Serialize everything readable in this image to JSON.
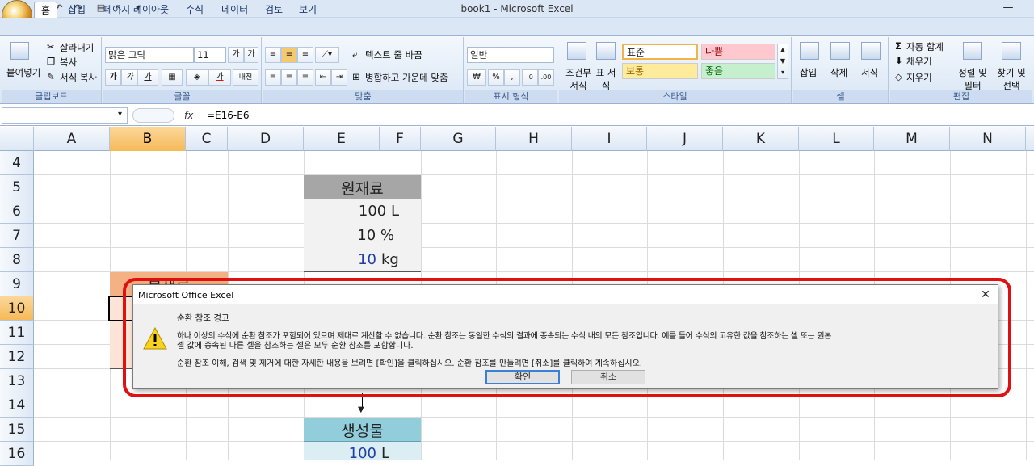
{
  "window": {
    "title": "book1 - Microsoft Excel",
    "minimize": "—"
  },
  "tabs": [
    "홈",
    "삽입",
    "페이지 레이아웃",
    "수식",
    "데이터",
    "검토",
    "보기"
  ],
  "ribbon": {
    "clipboard": {
      "label": "클립보드",
      "paste": "붙여넣기",
      "cut": "잘라내기",
      "copy": "복사",
      "format_painter": "서식 복사"
    },
    "font": {
      "label": "글꼴",
      "name": "맑은 고딕",
      "size": "11",
      "grow": "가",
      "shrink": "가",
      "bold": "가",
      "italic": "가",
      "underline": "가",
      "font_color": "가",
      "phonetic": "내천"
    },
    "alignment": {
      "label": "맞춤",
      "wrap": "텍스트 줄 바꿈",
      "merge": "병합하고 가운데 맞춤"
    },
    "number": {
      "label": "표시 형식",
      "format": "일반",
      "currency": "₩",
      "percent": "%",
      "comma": ","
    },
    "styles": {
      "label": "스타일",
      "conditional": "조건부 서식",
      "table": "표 서식",
      "normal": "표준",
      "bad": "나쁨",
      "neutral": "보통",
      "good": "좋음"
    },
    "cells": {
      "label": "셀",
      "insert": "삽입",
      "delete": "삭제",
      "format": "서식"
    },
    "editing": {
      "label": "편집",
      "autosum": "자동 합계",
      "fill": "채우기",
      "clear": "지우기",
      "sort": "정렬 및 필터",
      "find": "찾기 및 선택"
    }
  },
  "formula_bar": {
    "fx": "fx",
    "formula": "=E16-E6"
  },
  "columns": [
    "A",
    "B",
    "C",
    "D",
    "E",
    "F",
    "G",
    "H",
    "I",
    "J",
    "K",
    "L",
    "M",
    "N"
  ],
  "rows": [
    "4",
    "5",
    "6",
    "7",
    "8",
    "9",
    "10",
    "11",
    "12",
    "13",
    "14",
    "15",
    "16"
  ],
  "cells": {
    "raw_header": "원재료",
    "raw_1": "100 L",
    "raw_2": "10 %",
    "raw_3_num": "10",
    "raw_3_unit": "kg",
    "b9": "부재료",
    "product_header": "생성물",
    "product_num": "100",
    "product_unit": "L"
  },
  "dialog": {
    "title": "Microsoft Office Excel",
    "heading": "순환 참조 경고",
    "line1": "하나 이상의 수식에 순환 참조가 포함되어 있으며 제대로 계산할 수 없습니다. 순환 참조는 동일한 수식의 결과에 종속되는 수식 내의 모든 참조입니다. 예를 들어 수식의 고유한 값을 참조하는 셀 또는 원본",
    "line2": "셀 값에 종속된 다른 셀을 참조하는 셀은 모두 순환 참조를 포함합니다.",
    "line3": "순환 참조 이해, 검색 및 제거에 대한 자세한 내용을 보려면 [확인]을 클릭하십시오. 순환 참조를 만들려면 [취소]를 클릭하여 계속하십시오.",
    "ok": "확인",
    "cancel": "취소",
    "close": "✕"
  },
  "colors": {
    "accent": "#e01010",
    "raw_header_bg": "#a6a6a6",
    "product_header_bg": "#92cddc",
    "selected": "#f6b957"
  }
}
